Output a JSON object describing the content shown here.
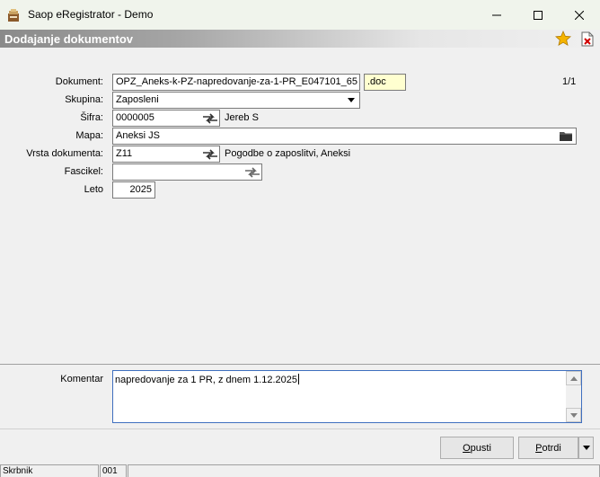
{
  "window": {
    "title": "Saop eRegistrator - Demo",
    "minimize_icon": "minimize-icon",
    "maximize_icon": "maximize-icon",
    "close_icon": "close-icon"
  },
  "header": {
    "title": "Dodajanje dokumentov",
    "favorite_icon": "star-icon",
    "delete_icon": "document-delete-icon"
  },
  "form": {
    "dokument": {
      "label": "Dokument:",
      "value": "OPZ_Aneks-k-PZ-napredovanje-za-1-PR_E047101_65",
      "extension": ".doc",
      "counter": "1/1"
    },
    "skupina": {
      "label": "Skupina:",
      "value": "Zaposleni"
    },
    "sifra": {
      "label": "Šifra:",
      "value": "0000005",
      "description": "Jereb S"
    },
    "mapa": {
      "label": "Mapa:",
      "value": "Aneksi JS"
    },
    "vrsta": {
      "label": "Vrsta dokumenta:",
      "value": "Z11",
      "description": "Pogodbe o zaposlitvi, Aneksi"
    },
    "fascikel": {
      "label": "Fascikel:",
      "value": ""
    },
    "leto": {
      "label": "Leto",
      "value": "2025"
    }
  },
  "comment": {
    "label": "Komentar",
    "value": "napredovanje za 1 PR, z dnem 1.12.2025"
  },
  "buttons": {
    "cancel_label": "Opusti",
    "confirm_label": "Potrdi"
  },
  "status": {
    "user": "Skrbnik",
    "code": "001"
  },
  "colors": {
    "accent_border": "#3f6fbf",
    "extension_bg": "#ffffd0",
    "star": "#f5b400"
  }
}
